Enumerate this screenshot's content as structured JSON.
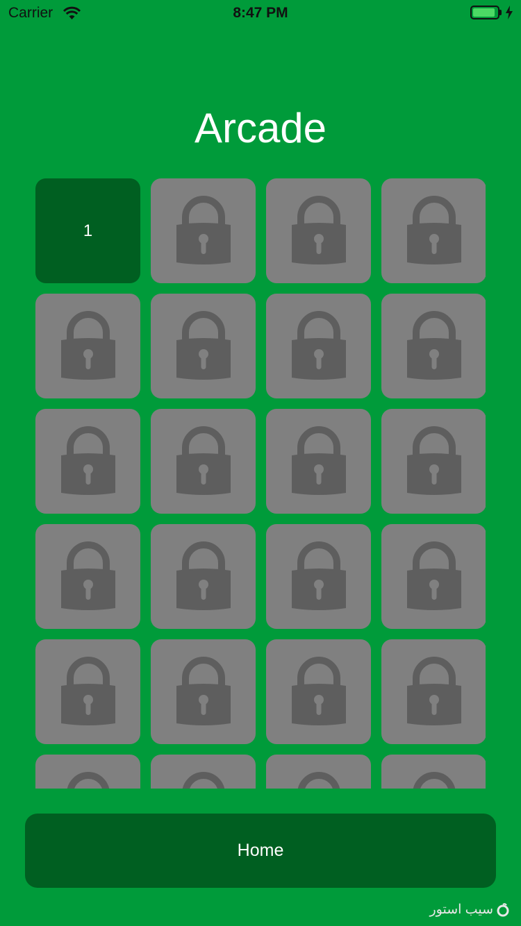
{
  "status_bar": {
    "carrier": "Carrier",
    "time": "8:47 PM",
    "battery_level": 0.9
  },
  "title": "Arcade",
  "levels": [
    {
      "label": "1",
      "locked": false
    },
    {
      "locked": true
    },
    {
      "locked": true
    },
    {
      "locked": true
    },
    {
      "locked": true
    },
    {
      "locked": true
    },
    {
      "locked": true
    },
    {
      "locked": true
    },
    {
      "locked": true
    },
    {
      "locked": true
    },
    {
      "locked": true
    },
    {
      "locked": true
    },
    {
      "locked": true
    },
    {
      "locked": true
    },
    {
      "locked": true
    },
    {
      "locked": true
    },
    {
      "locked": true
    },
    {
      "locked": true
    },
    {
      "locked": true
    },
    {
      "locked": true
    },
    {
      "locked": true
    },
    {
      "locked": true
    },
    {
      "locked": true
    },
    {
      "locked": true
    }
  ],
  "lock_icon": "lock-icon",
  "home_button": "Home",
  "watermark": "سیب استور",
  "colors": {
    "background": "#009b3a",
    "tile_locked": "#808080",
    "tile_unlocked": "#005f21",
    "lock": "#5e5e5e",
    "button": "#005f21"
  }
}
